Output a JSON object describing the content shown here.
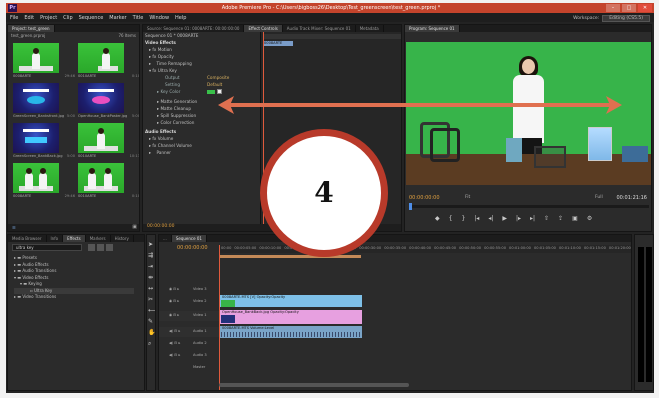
{
  "title": "Adobe Premiere Pro - C:\\Users\\bigboss26\\Desktop\\Test_greenscreen\\test_green.prproj *",
  "menu": [
    "File",
    "Edit",
    "Project",
    "Clip",
    "Sequence",
    "Marker",
    "Title",
    "Window",
    "Help"
  ],
  "workspace": {
    "label": "Workspace:",
    "value": "Editing (CS5.5)"
  },
  "project": {
    "tab": "Project: test_green",
    "file": "test_green.prproj",
    "count": "76 Items",
    "thumbs": [
      {
        "name": "0008ARTE",
        "dur": "29:46"
      },
      {
        "name": "0010ARTE",
        "dur": "0:10"
      },
      {
        "name": "0008ARTE",
        "dur": "29:46"
      },
      {
        "name": "0010ARTE",
        "dur": "0:10"
      },
      {
        "name": "GreenScreen_Banksfront.jpg",
        "dur": "5:00"
      },
      {
        "name": "OpenHouse_BankPoster.jpg",
        "dur": "5:00"
      },
      {
        "name": "GreenScreen_BankBack.jpg",
        "dur": "5:00"
      },
      {
        "name": "0010ARTE",
        "dur": "10:13"
      },
      {
        "name": "0008ARTE",
        "dur": "29:46"
      },
      {
        "name": "0010ARTE",
        "dur": "0:10"
      }
    ]
  },
  "source_tabs": [
    "Source: Sequence 01: 0008ARTE: 00:00:00:00",
    "Effect Controls",
    "Audio Track Mixer: Sequence 01",
    "Metadata"
  ],
  "effect_controls": {
    "header": "Sequence 01 * 0008ARTE",
    "clip": "0008ARTE",
    "video_effects": "Video Effects",
    "rows": [
      "Motion",
      "Opacity",
      "Time Remapping",
      "Ultra Key"
    ],
    "ultra": {
      "output_label": "Output",
      "output_value": "Composite",
      "setting_label": "Setting",
      "setting_value": "Default",
      "key_color": "Key Color"
    },
    "groups": [
      "Matte Generation",
      "Matte Cleanup",
      "Spill Suppression",
      "Color Correction"
    ],
    "audio_effects": "Audio Effects",
    "audio_rows": [
      "Volume",
      "Channel Volume",
      "Panner"
    ],
    "timecode": "00:00:00:00"
  },
  "program": {
    "tab": "Program: Sequence 01",
    "timecode": "00:00:00:00",
    "fit": "Fit",
    "ratio": "Full",
    "duration": "00:01:21:16"
  },
  "callout": {
    "number": "4"
  },
  "effects_panel": {
    "tabs": [
      "Media Browser",
      "Info",
      "Effects",
      "Markers",
      "History"
    ],
    "search": "ultra key",
    "items": [
      "Presets",
      "Audio Effects",
      "Audio Transitions",
      "Video Effects",
      "Keying",
      "Ultra Key",
      "Video Transitions"
    ]
  },
  "timeline": {
    "tab": "Sequence 01",
    "timecode": "00:00:00:00",
    "ruler": [
      "00:00",
      "00:00:05:00",
      "00:00:10:00",
      "00:00:15:00",
      "00:00:20:00",
      "00:00:25:00",
      "00:00:30:00",
      "00:00:35:00",
      "00:00:40:00",
      "00:00:45:00",
      "00:00:50:00",
      "00:00:55:00",
      "00:01:00:00",
      "00:01:05:00",
      "00:01:10:00",
      "00:01:15:00",
      "00:01:20:00"
    ],
    "tracks_video": [
      "Video 3",
      "Video 2",
      "Video 1"
    ],
    "tracks_audio": [
      "Audio 1",
      "Audio 2",
      "Audio 3",
      "Master"
    ],
    "clips": {
      "v2": "0008ARTE.MTS [V]  Opacity:Opacity",
      "v1": "OpenHouse_BankBack.jpg  Opacity:Opacity",
      "a1": "0008ARTE.MTS  Volume:Level"
    }
  }
}
